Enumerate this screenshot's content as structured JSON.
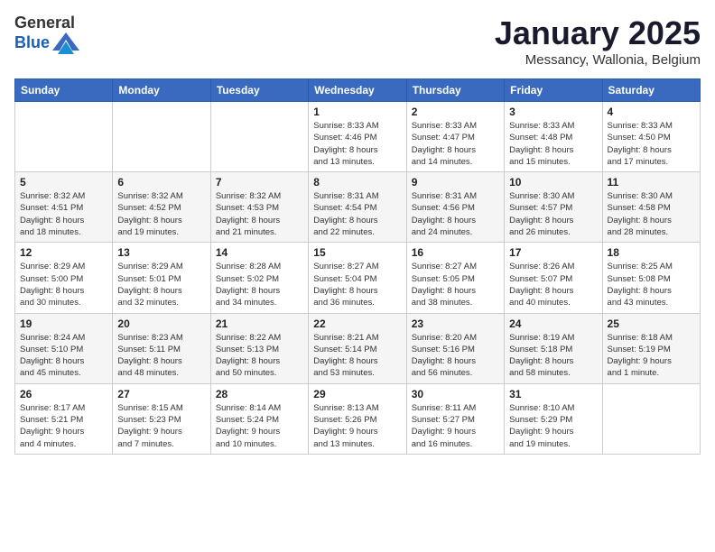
{
  "logo": {
    "general": "General",
    "blue": "Blue"
  },
  "header": {
    "month": "January 2025",
    "location": "Messancy, Wallonia, Belgium"
  },
  "weekdays": [
    "Sunday",
    "Monday",
    "Tuesday",
    "Wednesday",
    "Thursday",
    "Friday",
    "Saturday"
  ],
  "weeks": [
    [
      {
        "day": "",
        "info": ""
      },
      {
        "day": "",
        "info": ""
      },
      {
        "day": "",
        "info": ""
      },
      {
        "day": "1",
        "info": "Sunrise: 8:33 AM\nSunset: 4:46 PM\nDaylight: 8 hours\nand 13 minutes."
      },
      {
        "day": "2",
        "info": "Sunrise: 8:33 AM\nSunset: 4:47 PM\nDaylight: 8 hours\nand 14 minutes."
      },
      {
        "day": "3",
        "info": "Sunrise: 8:33 AM\nSunset: 4:48 PM\nDaylight: 8 hours\nand 15 minutes."
      },
      {
        "day": "4",
        "info": "Sunrise: 8:33 AM\nSunset: 4:50 PM\nDaylight: 8 hours\nand 17 minutes."
      }
    ],
    [
      {
        "day": "5",
        "info": "Sunrise: 8:32 AM\nSunset: 4:51 PM\nDaylight: 8 hours\nand 18 minutes."
      },
      {
        "day": "6",
        "info": "Sunrise: 8:32 AM\nSunset: 4:52 PM\nDaylight: 8 hours\nand 19 minutes."
      },
      {
        "day": "7",
        "info": "Sunrise: 8:32 AM\nSunset: 4:53 PM\nDaylight: 8 hours\nand 21 minutes."
      },
      {
        "day": "8",
        "info": "Sunrise: 8:31 AM\nSunset: 4:54 PM\nDaylight: 8 hours\nand 22 minutes."
      },
      {
        "day": "9",
        "info": "Sunrise: 8:31 AM\nSunset: 4:56 PM\nDaylight: 8 hours\nand 24 minutes."
      },
      {
        "day": "10",
        "info": "Sunrise: 8:30 AM\nSunset: 4:57 PM\nDaylight: 8 hours\nand 26 minutes."
      },
      {
        "day": "11",
        "info": "Sunrise: 8:30 AM\nSunset: 4:58 PM\nDaylight: 8 hours\nand 28 minutes."
      }
    ],
    [
      {
        "day": "12",
        "info": "Sunrise: 8:29 AM\nSunset: 5:00 PM\nDaylight: 8 hours\nand 30 minutes."
      },
      {
        "day": "13",
        "info": "Sunrise: 8:29 AM\nSunset: 5:01 PM\nDaylight: 8 hours\nand 32 minutes."
      },
      {
        "day": "14",
        "info": "Sunrise: 8:28 AM\nSunset: 5:02 PM\nDaylight: 8 hours\nand 34 minutes."
      },
      {
        "day": "15",
        "info": "Sunrise: 8:27 AM\nSunset: 5:04 PM\nDaylight: 8 hours\nand 36 minutes."
      },
      {
        "day": "16",
        "info": "Sunrise: 8:27 AM\nSunset: 5:05 PM\nDaylight: 8 hours\nand 38 minutes."
      },
      {
        "day": "17",
        "info": "Sunrise: 8:26 AM\nSunset: 5:07 PM\nDaylight: 8 hours\nand 40 minutes."
      },
      {
        "day": "18",
        "info": "Sunrise: 8:25 AM\nSunset: 5:08 PM\nDaylight: 8 hours\nand 43 minutes."
      }
    ],
    [
      {
        "day": "19",
        "info": "Sunrise: 8:24 AM\nSunset: 5:10 PM\nDaylight: 8 hours\nand 45 minutes."
      },
      {
        "day": "20",
        "info": "Sunrise: 8:23 AM\nSunset: 5:11 PM\nDaylight: 8 hours\nand 48 minutes."
      },
      {
        "day": "21",
        "info": "Sunrise: 8:22 AM\nSunset: 5:13 PM\nDaylight: 8 hours\nand 50 minutes."
      },
      {
        "day": "22",
        "info": "Sunrise: 8:21 AM\nSunset: 5:14 PM\nDaylight: 8 hours\nand 53 minutes."
      },
      {
        "day": "23",
        "info": "Sunrise: 8:20 AM\nSunset: 5:16 PM\nDaylight: 8 hours\nand 56 minutes."
      },
      {
        "day": "24",
        "info": "Sunrise: 8:19 AM\nSunset: 5:18 PM\nDaylight: 8 hours\nand 58 minutes."
      },
      {
        "day": "25",
        "info": "Sunrise: 8:18 AM\nSunset: 5:19 PM\nDaylight: 9 hours\nand 1 minute."
      }
    ],
    [
      {
        "day": "26",
        "info": "Sunrise: 8:17 AM\nSunset: 5:21 PM\nDaylight: 9 hours\nand 4 minutes."
      },
      {
        "day": "27",
        "info": "Sunrise: 8:15 AM\nSunset: 5:23 PM\nDaylight: 9 hours\nand 7 minutes."
      },
      {
        "day": "28",
        "info": "Sunrise: 8:14 AM\nSunset: 5:24 PM\nDaylight: 9 hours\nand 10 minutes."
      },
      {
        "day": "29",
        "info": "Sunrise: 8:13 AM\nSunset: 5:26 PM\nDaylight: 9 hours\nand 13 minutes."
      },
      {
        "day": "30",
        "info": "Sunrise: 8:11 AM\nSunset: 5:27 PM\nDaylight: 9 hours\nand 16 minutes."
      },
      {
        "day": "31",
        "info": "Sunrise: 8:10 AM\nSunset: 5:29 PM\nDaylight: 9 hours\nand 19 minutes."
      },
      {
        "day": "",
        "info": ""
      }
    ]
  ]
}
